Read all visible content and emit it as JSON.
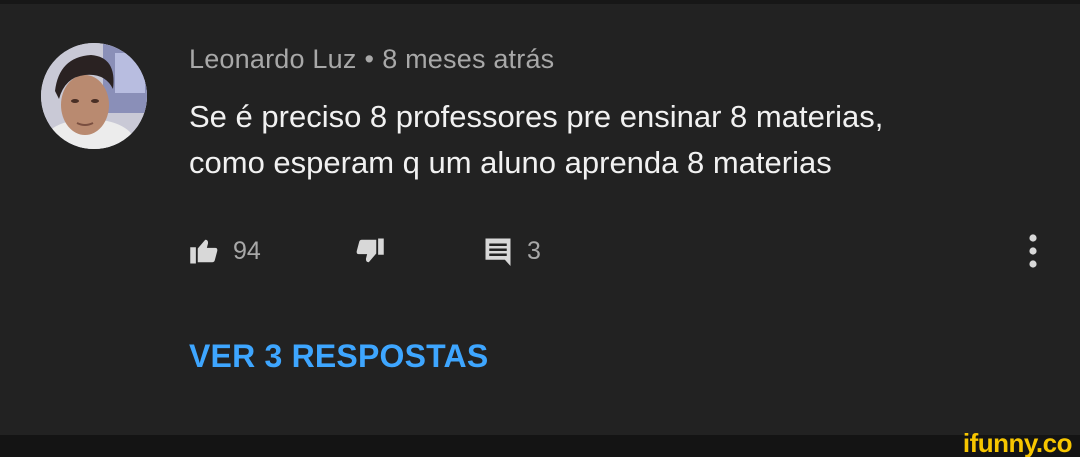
{
  "comment": {
    "author": "Leonardo Luz",
    "separator": "•",
    "timestamp": "8 meses atrás",
    "text_line1": "Se é preciso 8 professores pre ensinar 8 materias,",
    "text_line2": "como esperam q um aluno aprenda 8 materias"
  },
  "actions": {
    "like_count": "94",
    "reply_count": "3"
  },
  "replies": {
    "label": "VER 3 RESPOSTAS"
  },
  "icons": {
    "like": "thumbs-up-icon",
    "dislike": "thumbs-down-icon",
    "reply": "comment-icon",
    "more": "more-vertical-icon"
  },
  "colors": {
    "background": "#222222",
    "primary_text": "#f1f1f1",
    "secondary_text": "#a8a8a8",
    "link": "#3ea6ff",
    "watermark": "#f7c600"
  },
  "watermark": "ifunny.co"
}
